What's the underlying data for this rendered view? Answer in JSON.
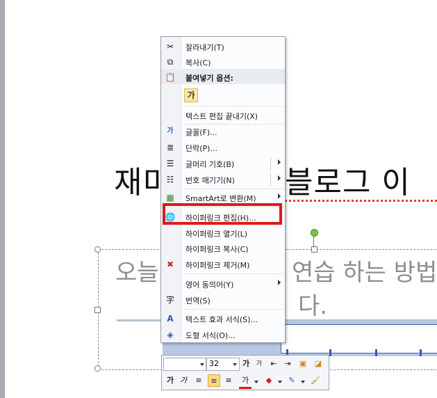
{
  "slide": {
    "title_left": "재미",
    "title_right": "블로그 이",
    "body_line1_left": "오늘",
    "body_line1_right": "연습 하는 방법",
    "body_line2": "다."
  },
  "context_menu": {
    "items": [
      {
        "label": "잘라내기(T)",
        "icon": "scissors-icon"
      },
      {
        "label": "복사(C)",
        "icon": "copy-icon"
      },
      {
        "label": "붙여넣기 옵션:",
        "icon": "paste-icon"
      },
      {
        "label": "가",
        "icon": "paste-option-text-icon"
      },
      {
        "label": "텍스트 편집 끝내기(X)",
        "icon": ""
      },
      {
        "label": "글꼴(F)...",
        "icon": "font-icon"
      },
      {
        "label": "단락(P)...",
        "icon": "paragraph-icon"
      },
      {
        "label": "글머리 기호(B)",
        "icon": "bullets-icon"
      },
      {
        "label": "번호 매기기(N)",
        "icon": "numbering-icon"
      },
      {
        "label": "SmartArt로 변환(M)",
        "icon": "smartart-icon"
      },
      {
        "label": "하이퍼링크 편집(H)...",
        "icon": "hyperlink-icon"
      },
      {
        "label": "하이퍼링크 열기(L)",
        "icon": ""
      },
      {
        "label": "하이퍼링크 복사(C)",
        "icon": ""
      },
      {
        "label": "하이퍼링크 제거(M)",
        "icon": "remove-link-icon"
      },
      {
        "label": "영어 동의어(Y)",
        "icon": ""
      },
      {
        "label": "번역(S)",
        "icon": "translate-icon"
      },
      {
        "label": "텍스트 효과 서식(S)...",
        "icon": "text-effects-icon"
      },
      {
        "label": "도형 서식(O)...",
        "icon": "format-shape-icon"
      }
    ]
  },
  "mini_toolbar": {
    "font_name": "",
    "font_size": "32",
    "grow_font": "가",
    "shrink_font": "가",
    "bold": "가",
    "italic": "가",
    "font_color_glyph": "가"
  },
  "colors": {
    "highlight": "#e01919",
    "selection": "#b8c8e3",
    "accent_blue": "#2f58c6"
  }
}
